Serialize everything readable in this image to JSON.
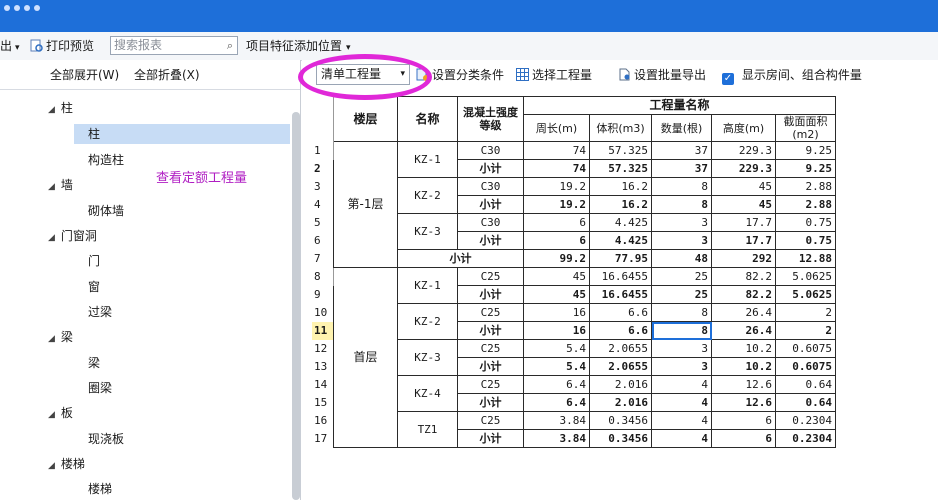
{
  "toolbar": {
    "export_label": "出",
    "print_preview_label": "打印预览",
    "search_placeholder": "搜索报表",
    "project_feature_label": "项目特征添加位置"
  },
  "left_toolbar": {
    "expand_all": "全部展开(W)",
    "collapse_all": "全部折叠(X)"
  },
  "tree": {
    "items": [
      {
        "label": "柱",
        "level": 0
      },
      {
        "label": "柱",
        "level": 1,
        "selected": true
      },
      {
        "label": "构造柱",
        "level": 1
      },
      {
        "label": "墙",
        "level": 0
      },
      {
        "label": "砌体墙",
        "level": 1
      },
      {
        "label": "门窗洞",
        "level": 0
      },
      {
        "label": "门",
        "level": 1
      },
      {
        "label": "窗",
        "level": 1
      },
      {
        "label": "过梁",
        "level": 1
      },
      {
        "label": "梁",
        "level": 0
      },
      {
        "label": "梁",
        "level": 1
      },
      {
        "label": "圈梁",
        "level": 1
      },
      {
        "label": "板",
        "level": 0
      },
      {
        "label": "现浇板",
        "level": 1
      },
      {
        "label": "楼梯",
        "level": 0
      },
      {
        "label": "楼梯",
        "level": 1
      }
    ]
  },
  "annotation": "查看定额工程量",
  "right_toolbar": {
    "mode_dropdown": "清单工程量",
    "set_category": "设置分类条件",
    "select_quantity": "选择工程量",
    "batch_export": "设置批量导出",
    "show_rooms": "显示房间、组合构件量"
  },
  "table": {
    "headers": {
      "floor": "楼层",
      "name": "名称",
      "concrete": "混凝土强度等级",
      "group": "工程量名称",
      "perimeter": "周长(m)",
      "volume": "体积(m3)",
      "count": "数量(根)",
      "height": "高度(m)",
      "section": "截面面积(m2)"
    },
    "subtotal_label": "小计",
    "rows": [
      {
        "n": "1",
        "floor": "第-1层",
        "name": "KZ-1",
        "grade": "C30",
        "p": "74",
        "v": "57.325",
        "c": "37",
        "h": "229.3",
        "s": "9.25"
      },
      {
        "n": "2",
        "grade": "小计",
        "p": "74",
        "v": "57.325",
        "c": "37",
        "h": "229.3",
        "s": "9.25",
        "bold": true
      },
      {
        "n": "3",
        "name": "KZ-2",
        "grade": "C30",
        "p": "19.2",
        "v": "16.2",
        "c": "8",
        "h": "45",
        "s": "2.88"
      },
      {
        "n": "4",
        "grade": "小计",
        "p": "19.2",
        "v": "16.2",
        "c": "8",
        "h": "45",
        "s": "2.88",
        "bold": true
      },
      {
        "n": "5",
        "name": "KZ-3",
        "grade": "C30",
        "p": "6",
        "v": "4.425",
        "c": "3",
        "h": "17.7",
        "s": "0.75"
      },
      {
        "n": "6",
        "grade": "小计",
        "p": "6",
        "v": "4.425",
        "c": "3",
        "h": "17.7",
        "s": "0.75",
        "bold": true
      },
      {
        "n": "7",
        "p": "99.2",
        "v": "77.95",
        "c": "48",
        "h": "292",
        "s": "12.88",
        "bold": true
      },
      {
        "n": "8",
        "floor": "首层",
        "name": "KZ-1",
        "grade": "C25",
        "p": "45",
        "v": "16.6455",
        "c": "25",
        "h": "82.2",
        "s": "5.0625"
      },
      {
        "n": "9",
        "grade": "小计",
        "p": "45",
        "v": "16.6455",
        "c": "25",
        "h": "82.2",
        "s": "5.0625",
        "bold": true
      },
      {
        "n": "10",
        "name": "KZ-2",
        "grade": "C25",
        "p": "16",
        "v": "6.6",
        "c": "8",
        "h": "26.4",
        "s": "2"
      },
      {
        "n": "11",
        "grade": "小计",
        "p": "16",
        "v": "6.6",
        "c": "8",
        "h": "26.4",
        "s": "2",
        "bold": true
      },
      {
        "n": "12",
        "name": "KZ-3",
        "grade": "C25",
        "p": "5.4",
        "v": "2.0655",
        "c": "3",
        "h": "10.2",
        "s": "0.6075"
      },
      {
        "n": "13",
        "grade": "小计",
        "p": "5.4",
        "v": "2.0655",
        "c": "3",
        "h": "10.2",
        "s": "0.6075",
        "bold": true
      },
      {
        "n": "14",
        "name": "KZ-4",
        "grade": "C25",
        "p": "6.4",
        "v": "2.016",
        "c": "4",
        "h": "12.6",
        "s": "0.64"
      },
      {
        "n": "15",
        "grade": "小计",
        "p": "6.4",
        "v": "2.016",
        "c": "4",
        "h": "12.6",
        "s": "0.64",
        "bold": true
      },
      {
        "n": "16",
        "name": "TZ1",
        "grade": "C25",
        "p": "3.84",
        "v": "0.3456",
        "c": "4",
        "h": "6",
        "s": "0.2304"
      },
      {
        "n": "17",
        "grade": "小计",
        "p": "3.84",
        "v": "0.3456",
        "c": "4",
        "h": "6",
        "s": "0.2304",
        "bold": true
      }
    ]
  },
  "colors": {
    "accent": "#1e6fd9",
    "highlight_ellipse": "#e028d8",
    "annotation": "#b01ec3"
  }
}
